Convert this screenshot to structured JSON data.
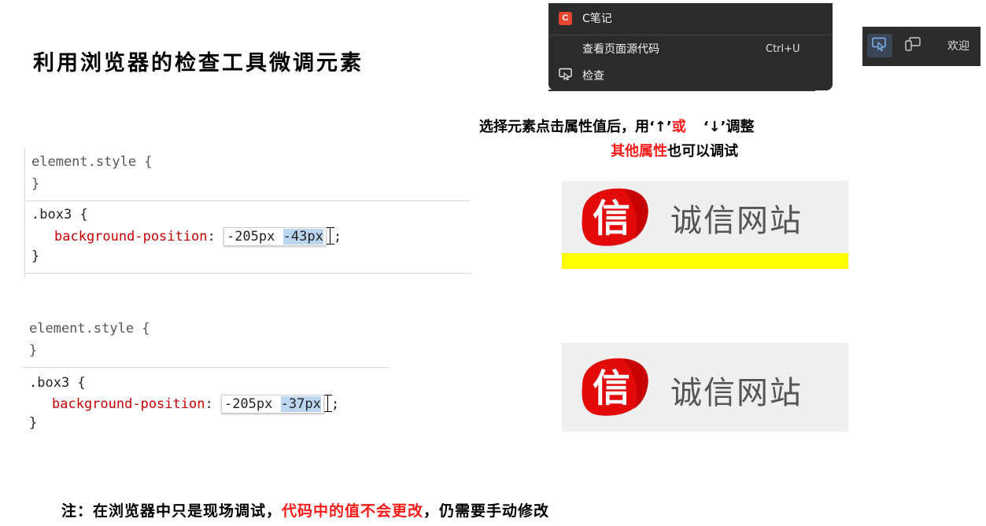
{
  "title": "利用浏览器的检查工具微调元素",
  "context_menu": {
    "app_item_icon_letter": "C",
    "app_item_label": "C笔记",
    "view_source_label": "查看页面源代码",
    "view_source_shortcut": "Ctrl+U",
    "inspect_label": "检查"
  },
  "devtools_toolbar": {
    "welcome_label": "欢迎"
  },
  "instruction": {
    "line1_part1": "选择元素点击属性值后，用‘↑’",
    "line1_or": "或",
    "line1_part2": "‘↓’调整",
    "line2_red": "其他属性",
    "line2_rest": "也可以调试"
  },
  "code_panel_1": {
    "element_style_open": "element.style {",
    "element_style_close": "}",
    "selector_open": ".box3 {",
    "property": "background-position",
    "colon": ": ",
    "value_x": "-205px",
    "value_y": "-43px",
    "semicolon": ";",
    "rule_close": "}"
  },
  "code_panel_2": {
    "element_style_open": "element.style {",
    "element_style_close": "}",
    "selector_open": ".box3 {",
    "property": "background-position",
    "colon": ": ",
    "value_x": "-205px",
    "value_y": "-37px",
    "semicolon": ";",
    "rule_close": "}"
  },
  "logo_preview_1": {
    "icon_char": "信",
    "text": "诚信网站"
  },
  "logo_preview_2": {
    "icon_char": "信",
    "text": "诚信网站"
  },
  "note": {
    "prefix": "注：在浏览器中只是现场调试，",
    "red": "代码中的值不会更改",
    "suffix": "，仍需要手动修改"
  },
  "colors": {
    "accent_red": "#ff1a1a",
    "css_property": "#c80000",
    "selection": "#bcd6f0",
    "menu_bg": "#2b2b2b",
    "logo_red": "#e30a0a",
    "yellow_bar": "#ffff00"
  }
}
